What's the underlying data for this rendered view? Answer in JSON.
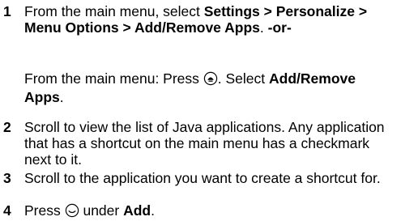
{
  "steps": [
    {
      "number": "1",
      "lead": "From the main menu, select ",
      "path": "Settings > Personalize > Menu Options > Add/Remove Apps",
      "sep": ". ",
      "or": "-or-",
      "alt_lead": "From the main menu: Press ",
      "alt_icon": "menu-key-icon",
      "alt_mid": ". Select ",
      "alt_target": "Add/Remove Apps",
      "alt_end": "."
    },
    {
      "number": "2",
      "text": "Scroll to view the list of Java applications. Any application that has a shortcut on the main menu has a checkmark next to it."
    },
    {
      "number": "3",
      "text": "Scroll to the application you want to create a shortcut for."
    },
    {
      "number": "4",
      "lead": "Press ",
      "icon": "left-soft-key-icon",
      "mid": " under ",
      "target": "Add",
      "end": "."
    }
  ]
}
